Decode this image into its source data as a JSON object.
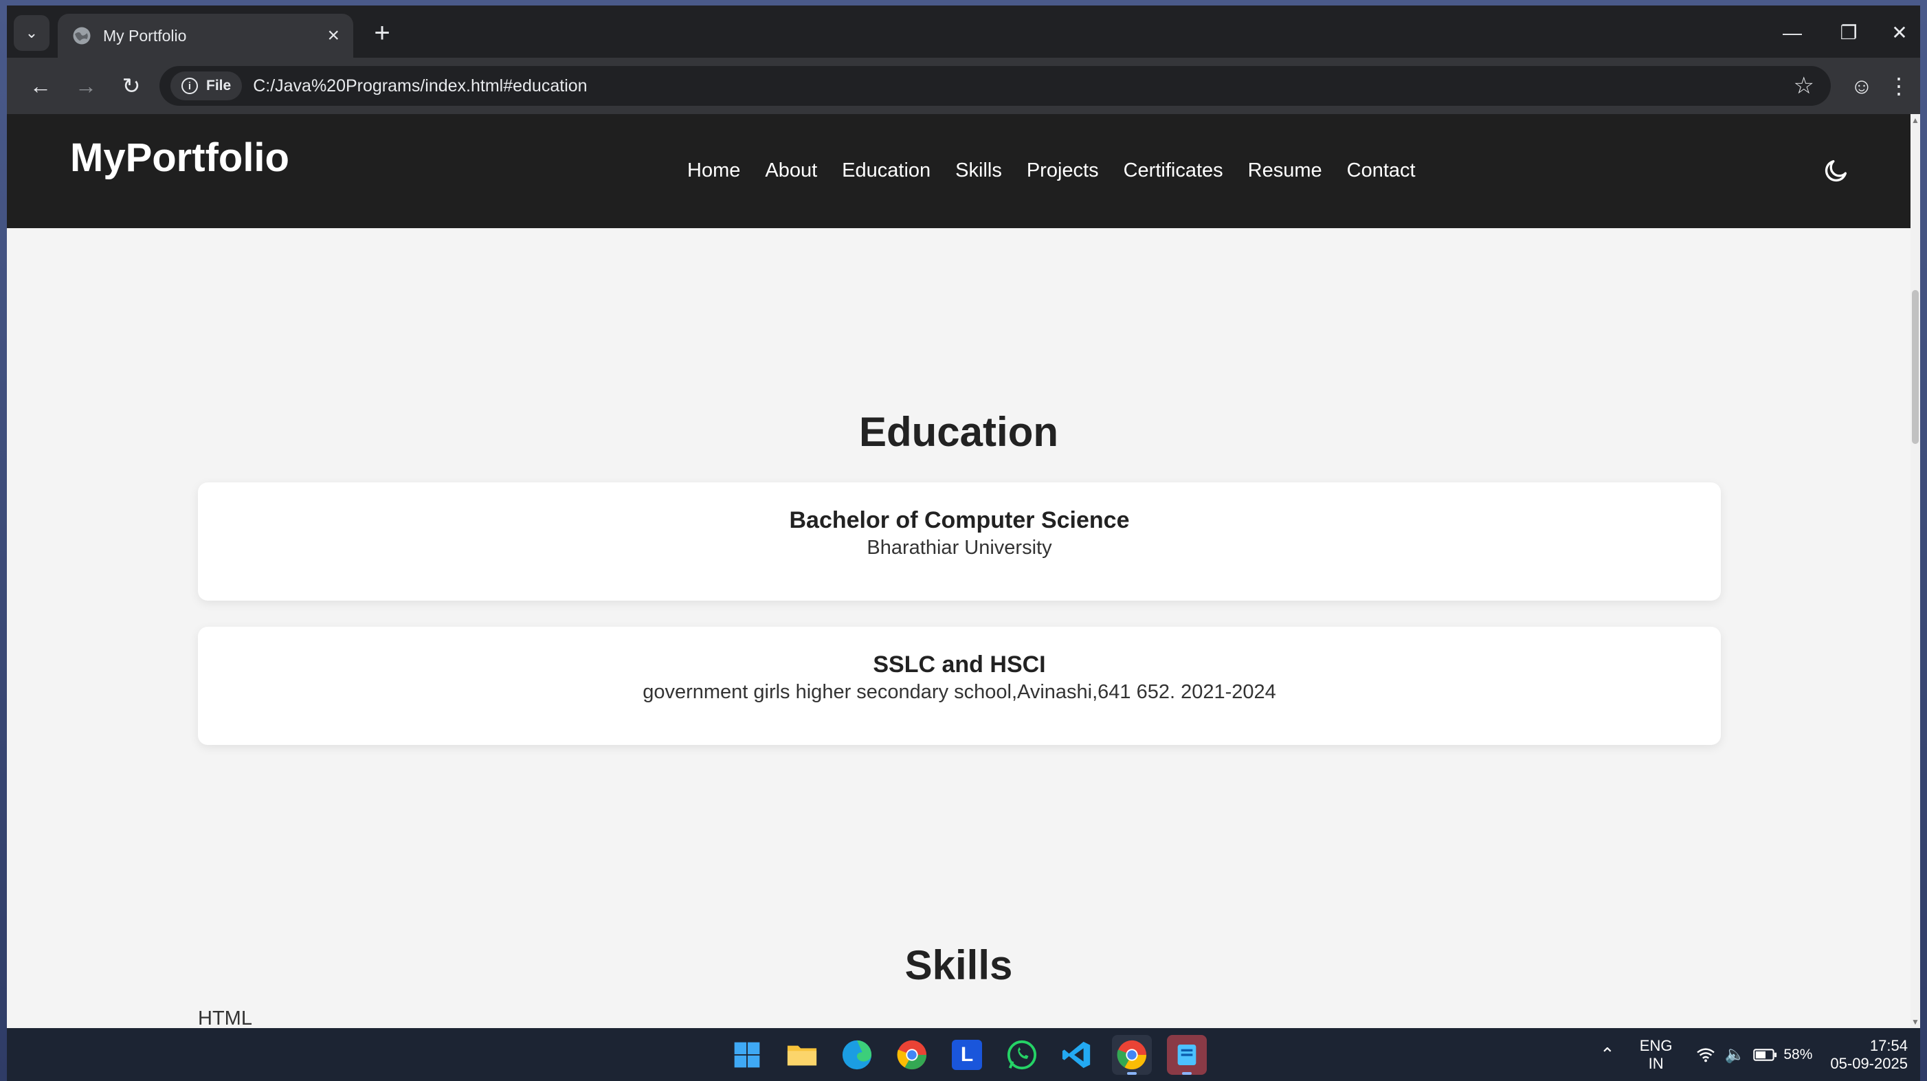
{
  "browser": {
    "tab_title": "My Portfolio",
    "url": "C:/Java%20Programs/index.html#education",
    "site_chip_label": "File",
    "icons": {
      "tab_search": "chevron-down-icon",
      "new_tab": "plus-icon",
      "back": "arrow-left-icon",
      "forward": "arrow-right-icon",
      "reload": "reload-icon",
      "bookmark": "star-icon",
      "profile": "profile-icon",
      "menu": "kebab-menu-icon",
      "minimize": "minimize-icon",
      "restore": "restore-icon",
      "close": "close-icon"
    }
  },
  "site": {
    "logo": "MyPortfolio",
    "nav": [
      "Home",
      "About",
      "Education",
      "Skills",
      "Projects",
      "Certificates",
      "Resume",
      "Contact"
    ],
    "theme_toggle_icon": "moon-icon",
    "education": {
      "heading": "Education",
      "entries": [
        {
          "degree": "Bachelor of Computer Science",
          "detail": "Bharathiar University"
        },
        {
          "degree": "SSLC and HSCI",
          "detail": "government girls higher secondary school,Avinashi,641 652. 2021-2024"
        }
      ]
    },
    "skills": {
      "heading": "Skills",
      "first_item": "HTML"
    },
    "colors": {
      "navbar_bg": "#1f1f1f",
      "page_bg": "#f4f4f4",
      "card_bg": "#ffffff"
    }
  },
  "taskbar": {
    "apps": [
      "windows-start-icon",
      "file-explorer-icon",
      "edge-icon",
      "chrome-canary-icon",
      "l-app-icon",
      "whatsapp-icon",
      "vscode-icon",
      "chrome-icon",
      "notepad-app-icon"
    ],
    "language_line1": "ENG",
    "language_line2": "IN",
    "battery": "58%",
    "time": "17:54",
    "date": "05-09-2025"
  }
}
